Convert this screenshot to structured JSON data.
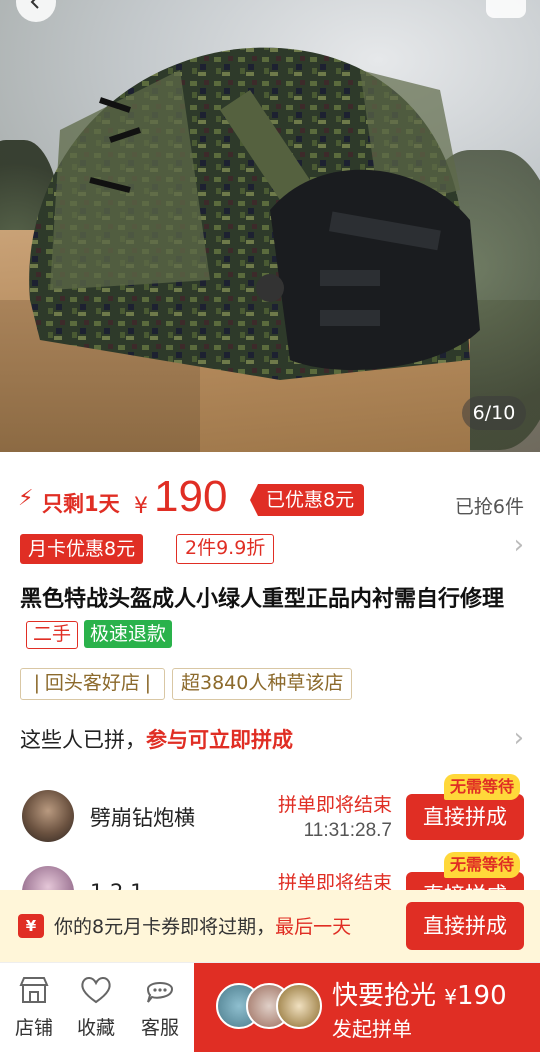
{
  "gallery": {
    "counter": "6/10"
  },
  "price": {
    "remaining": "只剩1天",
    "currency": "¥",
    "amount": "190",
    "discounted": "已优惠8元",
    "sold": "已抢6件"
  },
  "promo_tags": [
    "月卡优惠8元",
    "2件9.9折"
  ],
  "product": {
    "title": "黑色特战头盔成人小绿人重型正品内衬需自行修理",
    "tag_condition": "二手",
    "tag_refund": "极速退款"
  },
  "shop_tags": [
    "回头客好店",
    "超3840人种草该店"
  ],
  "group": {
    "header_text": "这些人已拼，",
    "header_highlight": "参与可立即拼成",
    "rows": [
      {
        "name": "劈崩钻炮横",
        "status": "拼单即将结束",
        "time": "11:31:28.7",
        "badge": "无需等待",
        "button": "直接拼成"
      },
      {
        "name": "1.2.1",
        "status": "拼单即将结束",
        "time": "",
        "badge": "无需等待",
        "button": "直接拼成"
      }
    ]
  },
  "coupon": {
    "icon": "¥",
    "text": "你的8元月卡券即将过期，",
    "last": "最后一天",
    "button": "直接拼成"
  },
  "bottom_nav": {
    "shop": "店铺",
    "favorite": "收藏",
    "service": "客服",
    "buy_main": "快要抢光",
    "buy_currency": "¥",
    "buy_price": "190",
    "buy_sub": "发起拼单"
  },
  "colors": {
    "accent": "#e02e24",
    "green": "#2ab24b",
    "coupon_bg": "#fff6d9",
    "gold": "#ffd83a"
  }
}
